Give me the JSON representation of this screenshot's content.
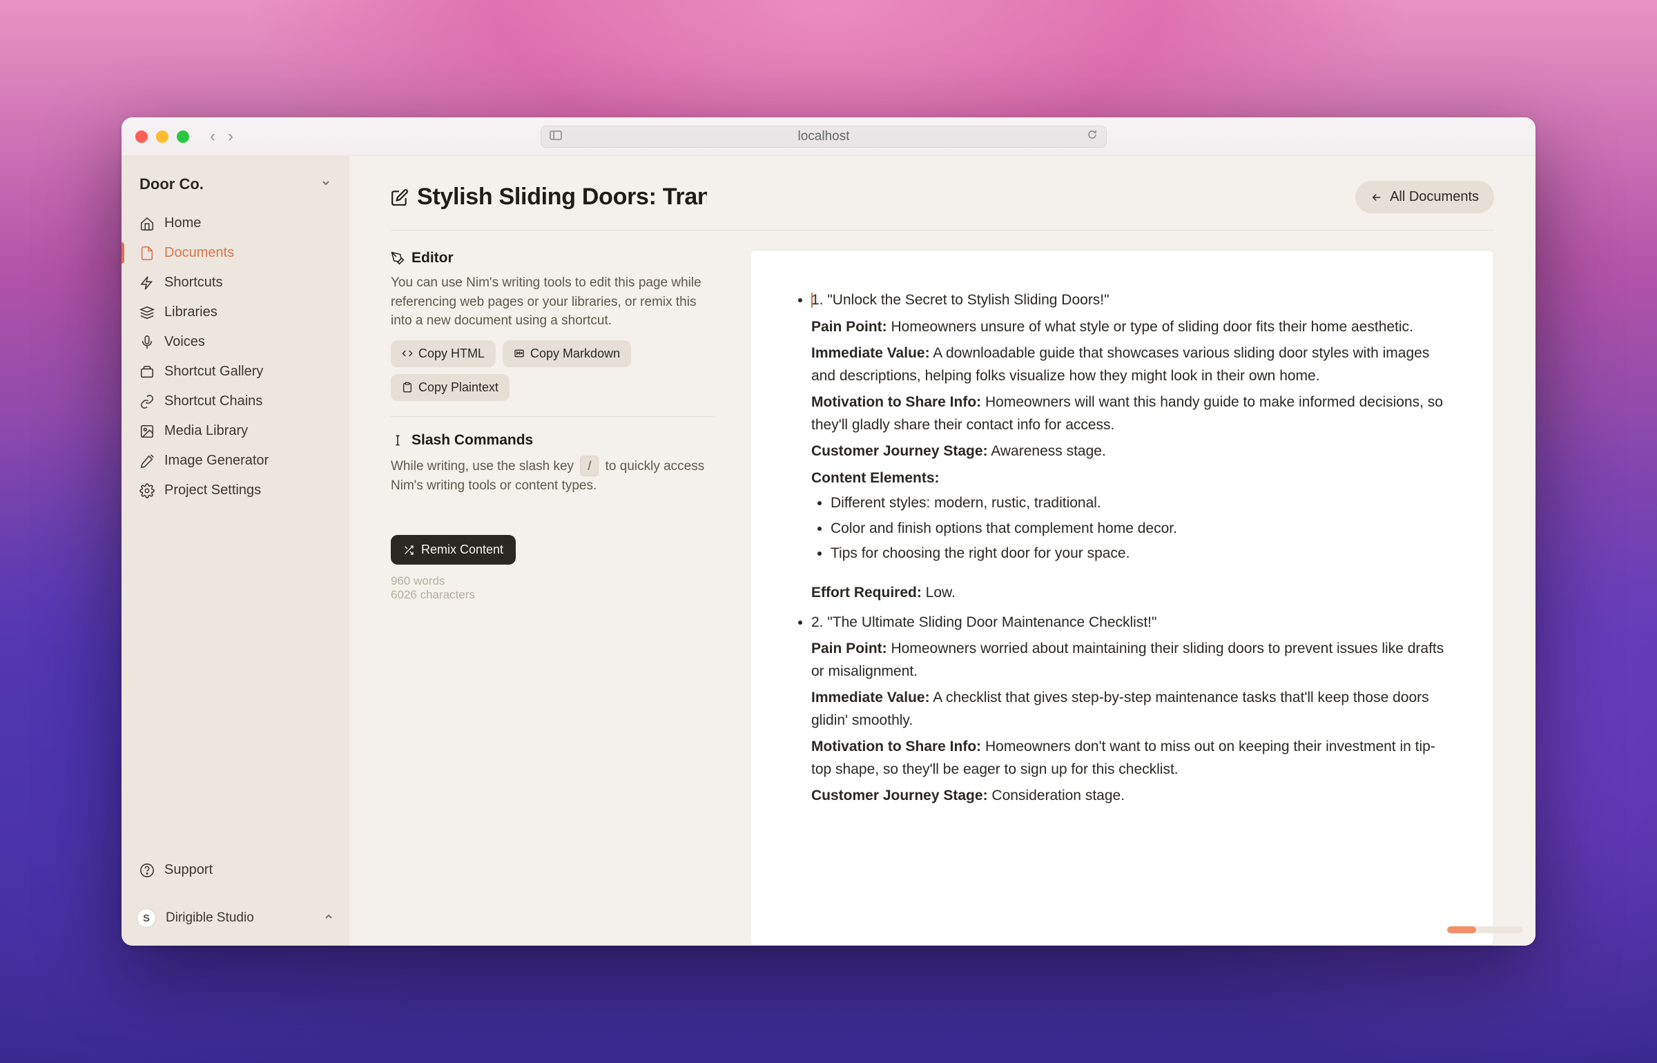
{
  "browser": {
    "url": "localhost"
  },
  "sidebar": {
    "workspace": "Door Co.",
    "items": [
      {
        "icon": "home",
        "label": "Home"
      },
      {
        "icon": "documents",
        "label": "Documents"
      },
      {
        "icon": "shortcuts",
        "label": "Shortcuts"
      },
      {
        "icon": "libraries",
        "label": "Libraries"
      },
      {
        "icon": "voices",
        "label": "Voices"
      },
      {
        "icon": "gallery",
        "label": "Shortcut Gallery"
      },
      {
        "icon": "chains",
        "label": "Shortcut Chains"
      },
      {
        "icon": "media",
        "label": "Media Library"
      },
      {
        "icon": "image-gen",
        "label": "Image Generator"
      },
      {
        "icon": "settings",
        "label": "Project Settings"
      }
    ],
    "active_index": 1,
    "support_label": "Support",
    "account": {
      "initial": "S",
      "name": "Dirigible Studio"
    }
  },
  "page": {
    "title": "Stylish Sliding Doors: Tran",
    "all_documents_label": "All Documents"
  },
  "editor_panel": {
    "title": "Editor",
    "description": "You can use Nim's writing tools to edit this page while referencing web pages or your libraries, or remix this into a new document using a shortcut.",
    "copy_html_label": "Copy HTML",
    "copy_markdown_label": "Copy Markdown",
    "copy_plaintext_label": "Copy Plaintext"
  },
  "slash_panel": {
    "title": "Slash Commands",
    "text_before": "While writing, use the slash key",
    "key": "/",
    "text_after": "to quickly access Nim's writing tools or content types."
  },
  "remix": {
    "label": "Remix Content"
  },
  "stats": {
    "words": "960",
    "words_label": "words",
    "chars": "6026",
    "chars_label": "characters"
  },
  "document": {
    "items": [
      {
        "title": "1. \"Unlock the Secret to Stylish Sliding Doors!\"",
        "pain_label": "Pain Point:",
        "pain": "Homeowners unsure of what style or type of sliding door fits their home aesthetic.",
        "value_label": "Immediate Value:",
        "value": "A downloadable guide that showcases various sliding door styles with images and descriptions, helping folks visualize how they might look in their own home.",
        "motivation_label": "Motivation to Share Info:",
        "motivation": "Homeowners will want this handy guide to make informed decisions, so they'll gladly share their contact info for access.",
        "stage_label": "Customer Journey Stage:",
        "stage": "Awareness stage.",
        "elements_label": "Content Elements:",
        "elements": [
          "Different styles: modern, rustic, traditional.",
          "Color and finish options that complement home decor.",
          "Tips for choosing the right door for your space."
        ],
        "effort_label": "Effort Required:",
        "effort": "Low."
      },
      {
        "title": "2. \"The Ultimate Sliding Door Maintenance Checklist!\"",
        "pain_label": "Pain Point:",
        "pain": "Homeowners worried about maintaining their sliding doors to prevent issues like drafts or misalignment.",
        "value_label": "Immediate Value:",
        "value": "A checklist that gives step-by-step maintenance tasks that'll keep those doors glidin' smoothly.",
        "motivation_label": "Motivation to Share Info:",
        "motivation": "Homeowners don't want to miss out on keeping their investment in tip-top shape, so they'll be eager to sign up for this checklist.",
        "stage_label": "Customer Journey Stage:",
        "stage": "Consideration stage."
      }
    ]
  }
}
